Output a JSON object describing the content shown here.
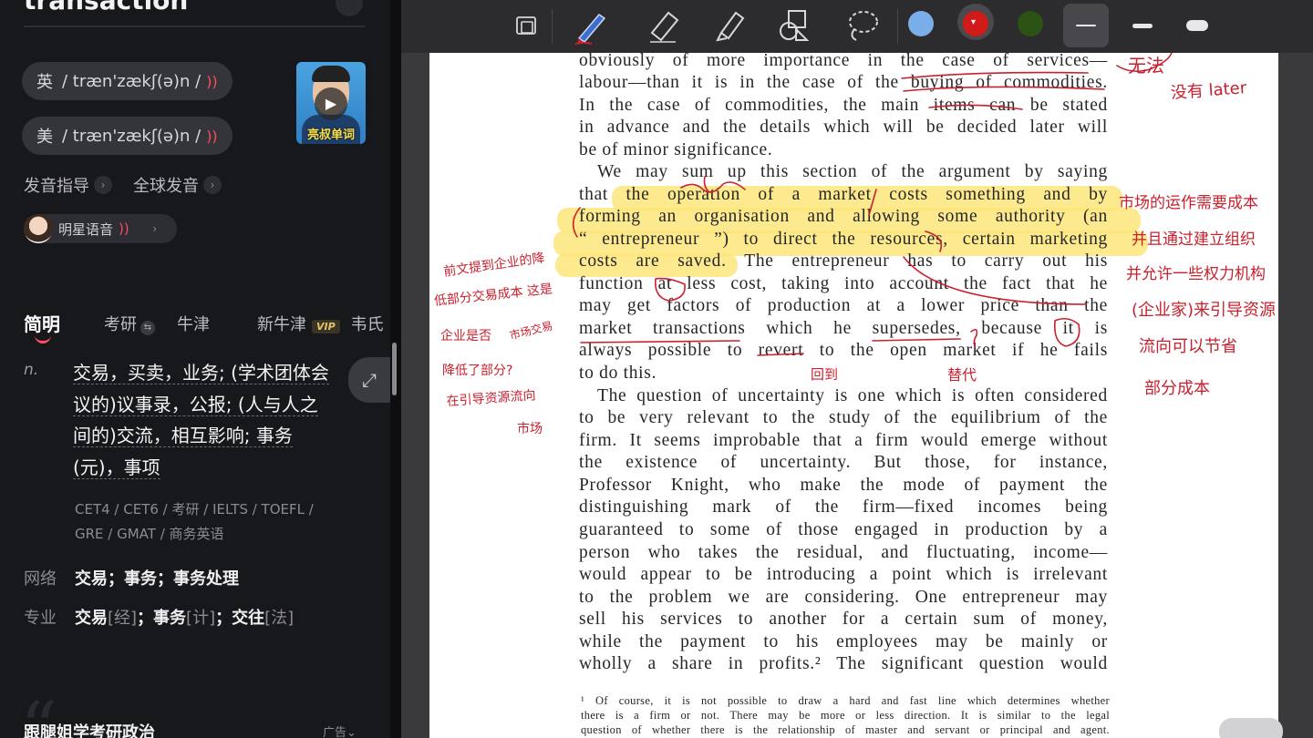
{
  "dict": {
    "word": "transaction",
    "pron_uk": {
      "region": "英",
      "ipa": "/ træn'zækʃ(ə)n /",
      "speaker": "🔊"
    },
    "pron_us": {
      "region": "美",
      "ipa": "/ træn'zækʃ(ə)n /",
      "speaker": "🔊"
    },
    "video_caption": "亮叔单词",
    "links": [
      "发音指导",
      "全球发音"
    ],
    "star_voice": "明星语音",
    "tabs": [
      "简明",
      "考研",
      "牛津",
      "新牛津",
      "韦氏"
    ],
    "vip_badge": "VIP",
    "pos": "n.",
    "definitions": "交易，买卖，业务; (学术团体会议的)议事录，公报; (人与人之间的)交流，相互影响; 事务(元)，事项",
    "def_lines": [
      "交易，买卖，业务; (学术团体会",
      "议的)议事录，公报; (人与人之",
      "间的)交流，相互影响; 事务",
      "(元)，事项"
    ],
    "exam_tags": [
      "CET4 / CET6 / 考研 / IELTS / TOEFL /",
      "GRE / GMAT / 商务英语"
    ],
    "network": {
      "label": "网络",
      "value": "交易；事务；事务处理"
    },
    "professional": {
      "label": "专业",
      "items": [
        {
          "t": "交易",
          "d": "[经]"
        },
        {
          "t": "事务",
          "d": "[计]"
        },
        {
          "t": "交往",
          "d": "[法]"
        }
      ]
    },
    "ad_title": "跟腿姐学考研政治",
    "ad_label": "广告"
  },
  "toolbar": {
    "tools": [
      "page-view-icon",
      "pen-icon",
      "eraser-icon",
      "highlighter-icon",
      "shapes-icon",
      "lasso-icon"
    ],
    "colors": [
      "#7aaee8",
      "#d11a1a",
      "#2d5216"
    ],
    "selected_color": "#d11a1a",
    "stroke_sizes": [
      "thin",
      "medium",
      "thick"
    ],
    "selected_stroke": "thin"
  },
  "document": {
    "lines": [
      "obviously of more importance in the case of services—",
      "labour—than it is in the case of the buying of commodities.",
      "In the case of commodities, the main items can be stated",
      "in advance and the details which will be decided later will",
      "be of minor significance.",
      "We may sum up this section of the argument by saying",
      "that the operation of a market costs something and by",
      "forming an organisation and allowing some authority (an",
      "“ entrepreneur ”) to direct the resources, certain marketing",
      "costs are saved. The entrepreneur has to carry out his",
      "function at less cost, taking into account the fact that he",
      "may get factors of production at a lower price than the",
      "market transactions which he supersedes, because it is",
      "always possible to revert to the open market if he fails",
      "to do this.",
      "The question of uncertainty is one which is often considered",
      "to be very relevant to the study of the equilibrium of the",
      "firm. It seems improbable that a firm would emerge without",
      "the existence of uncertainty. But those, for instance,",
      "Professor Knight, who make the mode of payment the",
      "distinguishing mark of the firm—fixed incomes being",
      "guaranteed to some of those engaged in production by a",
      "person who takes the residual, and fluctuating, income—",
      "would appear to be introducing a point which is irrelevant",
      "to the problem we are considering. One entrepreneur may",
      "sell his services to another for a certain sum of money,",
      "while the payment to his employees may be mainly or",
      "wholly a share in profits.² The significant question would"
    ],
    "footnotes": [
      "¹ Of course, it is not possible to draw a hard and fast line which determines whether",
      "there is a firm or not. There may be more or less direction. It is similar to the legal",
      "question of whether there is the relationship of master and servant or principal and agent."
    ],
    "annotations": {
      "top_right_1": "无法",
      "top_right_2": "没有 later",
      "right_1": "市场的运作需要成本",
      "right_2": "并且通过建立组织",
      "right_3": "并允许一些权力机构",
      "right_4": "(企业家)来引导资源",
      "right_5": "流向可以节省",
      "right_6": "部分成本",
      "left_1": "前文提到企业的降",
      "left_2": "低部分交易成本 这是",
      "left_3": "企业是否",
      "left_4": "降低了部分?",
      "left_5": "在引导资源流向",
      "left_6": "市场",
      "left_small": "市场交易",
      "under_revert": "回到",
      "under_supersede": "替代"
    }
  }
}
